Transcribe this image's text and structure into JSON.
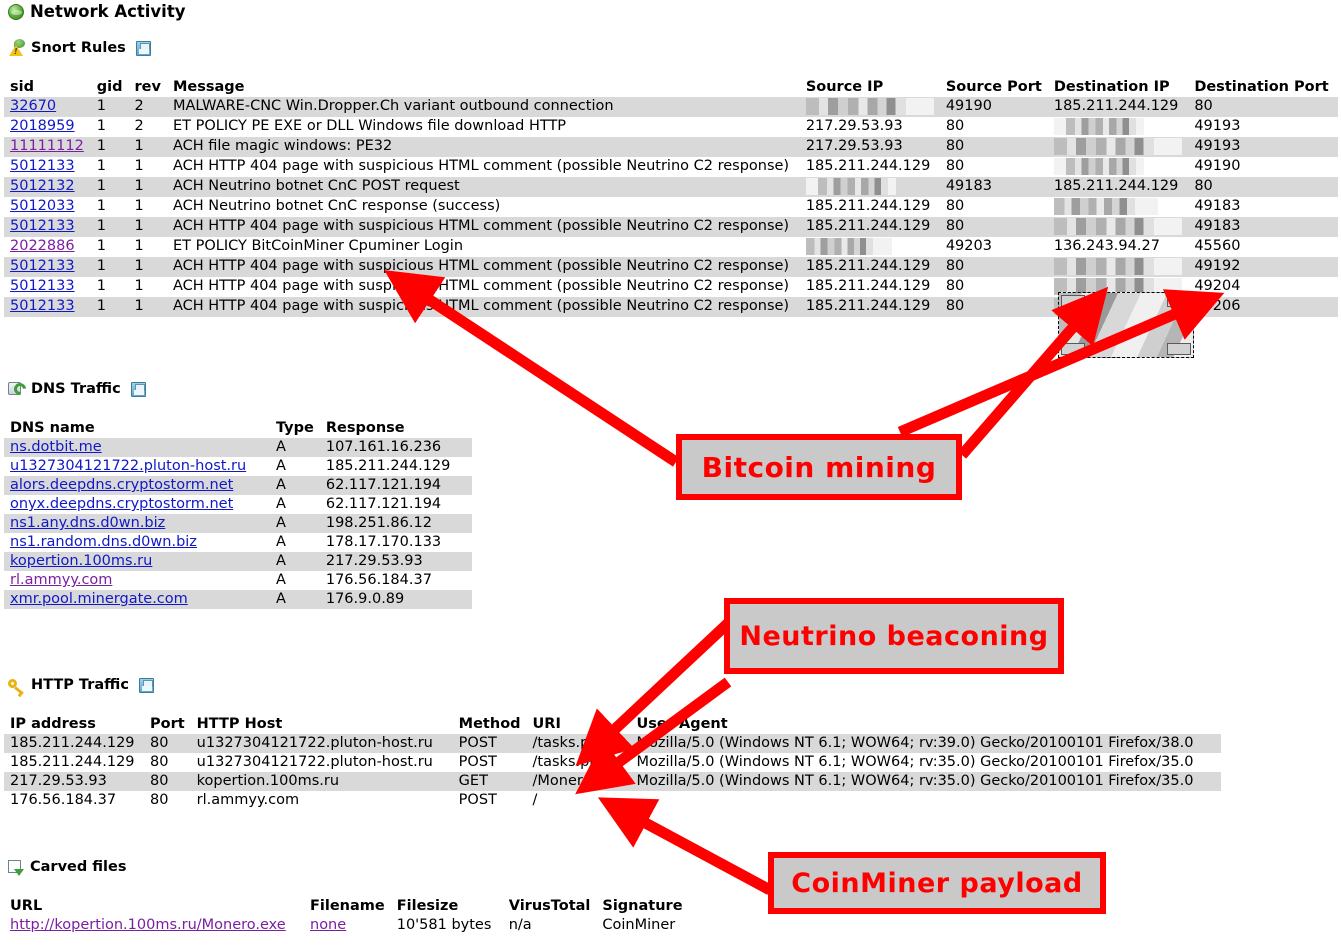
{
  "page": {
    "title": "Network Activity"
  },
  "sections": {
    "snort": {
      "title": "Snort Rules",
      "columns": [
        "sid",
        "gid",
        "rev",
        "Message",
        "Source IP",
        "Source Port",
        "Destination IP",
        "Destination Port"
      ],
      "rows": [
        {
          "sid": "32670",
          "gid": "1",
          "rev": "2",
          "message": "MALWARE-CNC Win.Dropper.Ch variant outbound connection",
          "src_ip": "[redacted]",
          "src_port": "49190",
          "dst_ip": "185.211.244.129",
          "dst_port": "80",
          "sid_visited": false,
          "src_redacted": true,
          "dst_redacted": false
        },
        {
          "sid": "2018959",
          "gid": "1",
          "rev": "2",
          "message": "ET POLICY PE EXE or DLL Windows file download HTTP",
          "src_ip": "217.29.53.93",
          "src_port": "80",
          "dst_ip": "[redacted]",
          "dst_port": "49193",
          "sid_visited": false,
          "src_redacted": false,
          "dst_redacted": true
        },
        {
          "sid": "11111112",
          "gid": "1",
          "rev": "1",
          "message": "ACH file magic windows: PE32",
          "src_ip": "217.29.53.93",
          "src_port": "80",
          "dst_ip": "[redacted]",
          "dst_port": "49193",
          "sid_visited": true,
          "src_redacted": false,
          "dst_redacted": true
        },
        {
          "sid": "5012133",
          "gid": "1",
          "rev": "1",
          "message": "ACH HTTP 404 page with suspicious HTML comment (possible Neutrino C2 response)",
          "src_ip": "185.211.244.129",
          "src_port": "80",
          "dst_ip": "[redacted]",
          "dst_port": "49190",
          "sid_visited": false,
          "src_redacted": false,
          "dst_redacted": true
        },
        {
          "sid": "5012132",
          "gid": "1",
          "rev": "1",
          "message": "ACH Neutrino botnet CnC POST request",
          "src_ip": "[redacted]",
          "src_port": "49183",
          "dst_ip": "185.211.244.129",
          "dst_port": "80",
          "sid_visited": false,
          "src_redacted": true,
          "dst_redacted": false
        },
        {
          "sid": "5012033",
          "gid": "1",
          "rev": "1",
          "message": "ACH Neutrino botnet CnC response (success)",
          "src_ip": "185.211.244.129",
          "src_port": "80",
          "dst_ip": "[redacted]",
          "dst_port": "49183",
          "sid_visited": false,
          "src_redacted": false,
          "dst_redacted": true
        },
        {
          "sid": "5012133",
          "gid": "1",
          "rev": "1",
          "message": "ACH HTTP 404 page with suspicious HTML comment (possible Neutrino C2 response)",
          "src_ip": "185.211.244.129",
          "src_port": "80",
          "dst_ip": "[redacted]",
          "dst_port": "49183",
          "sid_visited": false,
          "src_redacted": false,
          "dst_redacted": true
        },
        {
          "sid": "2022886",
          "gid": "1",
          "rev": "1",
          "message": "ET POLICY BitCoinMiner Cpuminer Login",
          "src_ip": "[redacted]",
          "src_port": "49203",
          "dst_ip": "136.243.94.27",
          "dst_port": "45560",
          "sid_visited": true,
          "src_redacted": true,
          "dst_redacted": false
        },
        {
          "sid": "5012133",
          "gid": "1",
          "rev": "1",
          "message": "ACH HTTP 404 page with suspicious HTML comment (possible Neutrino C2 response)",
          "src_ip": "185.211.244.129",
          "src_port": "80",
          "dst_ip": "[redacted]",
          "dst_port": "49192",
          "sid_visited": false,
          "src_redacted": false,
          "dst_redacted": true
        },
        {
          "sid": "5012133",
          "gid": "1",
          "rev": "1",
          "message": "ACH HTTP 404 page with suspicious HTML comment (possible Neutrino C2 response)",
          "src_ip": "185.211.244.129",
          "src_port": "80",
          "dst_ip": "[redacted]",
          "dst_port": "49204",
          "sid_visited": false,
          "src_redacted": false,
          "dst_redacted": true
        },
        {
          "sid": "5012133",
          "gid": "1",
          "rev": "1",
          "message": "ACH HTTP 404 page with suspicious HTML comment (possible Neutrino C2 response)",
          "src_ip": "185.211.244.129",
          "src_port": "80",
          "dst_ip": "[redacted]",
          "dst_port": "49206",
          "sid_visited": false,
          "src_redacted": false,
          "dst_redacted": true
        }
      ]
    },
    "dns": {
      "title": "DNS Traffic",
      "columns": [
        "DNS name",
        "Type",
        "Response"
      ],
      "rows": [
        {
          "name": "ns.dotbit.me",
          "type": "A",
          "response": "107.161.16.236",
          "visited": false
        },
        {
          "name": "u1327304121722.pluton-host.ru",
          "type": "A",
          "response": "185.211.244.129",
          "visited": false
        },
        {
          "name": "alors.deepdns.cryptostorm.net",
          "type": "A",
          "response": "62.117.121.194",
          "visited": false
        },
        {
          "name": "onyx.deepdns.cryptostorm.net",
          "type": "A",
          "response": "62.117.121.194",
          "visited": false
        },
        {
          "name": "ns1.any.dns.d0wn.biz",
          "type": "A",
          "response": "198.251.86.12",
          "visited": false
        },
        {
          "name": "ns1.random.dns.d0wn.biz",
          "type": "A",
          "response": "178.17.170.133",
          "visited": false
        },
        {
          "name": "kopertion.100ms.ru",
          "type": "A",
          "response": "217.29.53.93",
          "visited": false
        },
        {
          "name": "rl.ammyy.com",
          "type": "A",
          "response": "176.56.184.37",
          "visited": true
        },
        {
          "name": "xmr.pool.minergate.com",
          "type": "A",
          "response": "176.9.0.89",
          "visited": false
        }
      ]
    },
    "http": {
      "title": "HTTP Traffic",
      "columns": [
        "IP address",
        "Port",
        "HTTP Host",
        "Method",
        "URI",
        "User Agent"
      ],
      "rows": [
        {
          "ip": "185.211.244.129",
          "port": "80",
          "host": "u1327304121722.pluton-host.ru",
          "method": "POST",
          "uri": "/tasks.php",
          "ua": "Mozilla/5.0 (Windows NT 6.1; WOW64; rv:39.0) Gecko/20100101 Firefox/38.0"
        },
        {
          "ip": "185.211.244.129",
          "port": "80",
          "host": "u1327304121722.pluton-host.ru",
          "method": "POST",
          "uri": "/tasks.php",
          "ua": "Mozilla/5.0 (Windows NT 6.1; WOW64; rv:35.0) Gecko/20100101 Firefox/35.0"
        },
        {
          "ip": "217.29.53.93",
          "port": "80",
          "host": "kopertion.100ms.ru",
          "method": "GET",
          "uri": "/Monero.exe",
          "ua": "Mozilla/5.0 (Windows NT 6.1; WOW64; rv:35.0) Gecko/20100101 Firefox/35.0"
        },
        {
          "ip": "176.56.184.37",
          "port": "80",
          "host": "rl.ammyy.com",
          "method": "POST",
          "uri": "/",
          "ua": ""
        }
      ]
    },
    "carved": {
      "title": "Carved files",
      "columns": [
        "URL",
        "Filename",
        "Filesize",
        "VirusTotal",
        "Signature"
      ],
      "rows": [
        {
          "url": "http://kopertion.100ms.ru/Monero.exe",
          "filename": "none",
          "filesize": "10'581 bytes",
          "virustotal": "n/a",
          "signature": "CoinMiner"
        }
      ]
    }
  },
  "annotations": [
    {
      "id": "bitcoin-mining",
      "label": "Bitcoin    mining"
    },
    {
      "id": "neutrino-beaconing",
      "label": "Neutrino beaconing"
    },
    {
      "id": "coinminer-payload",
      "label": "CoinMiner payload"
    }
  ],
  "colors": {
    "annotation_red": "#ff0000",
    "annotation_fill": "#c9c9c9",
    "row_alt": "#d9d9d9",
    "link": "#1018c8",
    "link_visited": "#7b1fa2"
  }
}
